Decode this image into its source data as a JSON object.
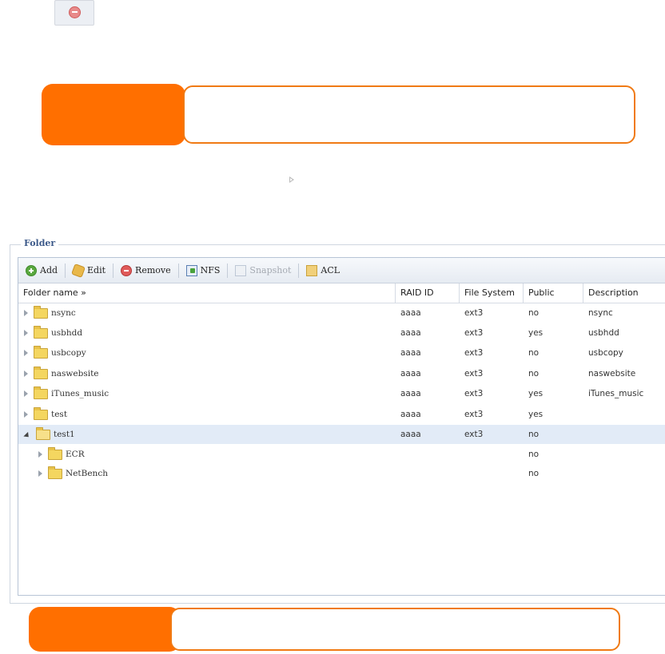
{
  "top_icon": {
    "icon": "remove-icon"
  },
  "legend": {
    "title": "Folder"
  },
  "toolbar": {
    "buttons": [
      {
        "label": "Add",
        "icon": "add-icon"
      },
      {
        "label": "Edit",
        "icon": "edit-icon"
      },
      {
        "label": "Remove",
        "icon": "remove-icon"
      },
      {
        "label": "NFS",
        "icon": "nfs-icon"
      },
      {
        "label": "Snapshot",
        "icon": "snapshot-icon",
        "disabled": true
      },
      {
        "label": "ACL",
        "icon": "acl-icon"
      }
    ]
  },
  "columns": [
    "Folder name »",
    "RAID ID",
    "File System",
    "Public",
    "Description"
  ],
  "rows": [
    {
      "name": "nsync",
      "raid": "aaaa",
      "fs": "ext3",
      "public": "no",
      "desc": "nsync"
    },
    {
      "name": "usbhdd",
      "raid": "aaaa",
      "fs": "ext3",
      "public": "yes",
      "desc": "usbhdd"
    },
    {
      "name": "usbcopy",
      "raid": "aaaa",
      "fs": "ext3",
      "public": "no",
      "desc": "usbcopy"
    },
    {
      "name": "naswebsite",
      "raid": "aaaa",
      "fs": "ext3",
      "public": "no",
      "desc": "naswebsite"
    },
    {
      "name": "iTunes_music",
      "raid": "aaaa",
      "fs": "ext3",
      "public": "yes",
      "desc": "iTunes_music"
    },
    {
      "name": "test",
      "raid": "aaaa",
      "fs": "ext3",
      "public": "yes",
      "desc": ""
    },
    {
      "name": "test1",
      "raid": "aaaa",
      "fs": "ext3",
      "public": "no",
      "desc": ""
    },
    {
      "name": "ECR",
      "raid": "",
      "fs": "",
      "public": "no",
      "desc": ""
    },
    {
      "name": "NetBench",
      "raid": "",
      "fs": "",
      "public": "no",
      "desc": ""
    }
  ],
  "colors": {
    "callout": "#ff6f00",
    "selected_row": "#e2ebf7"
  }
}
